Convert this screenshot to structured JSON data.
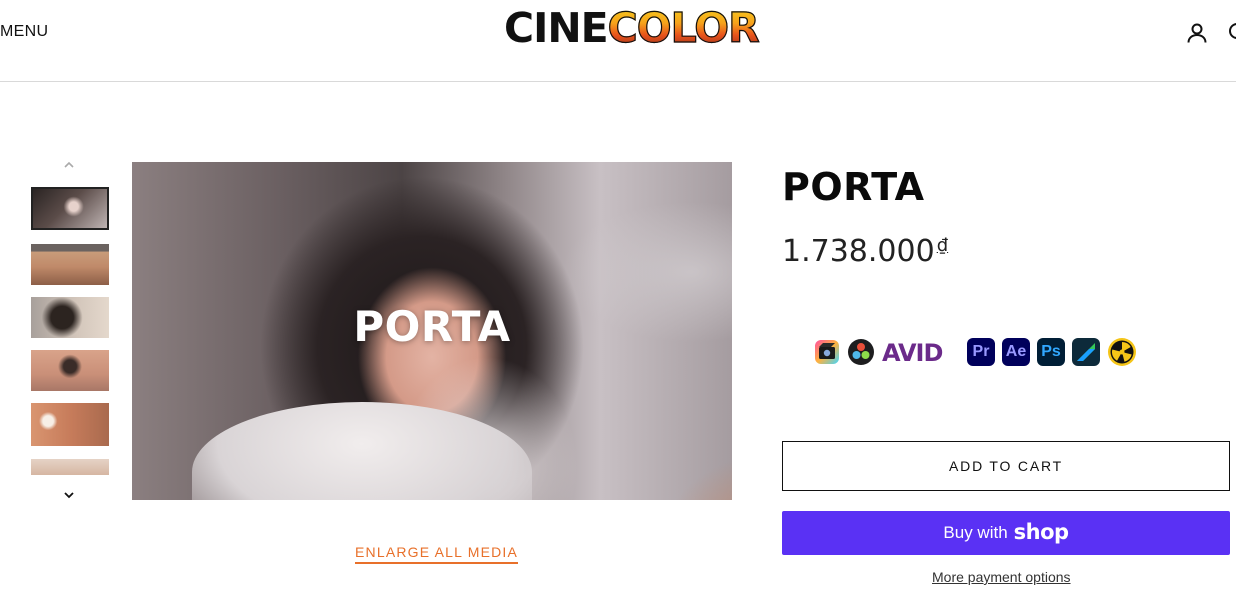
{
  "header": {
    "menu_label": "MENU",
    "logo": {
      "part1": "CINE",
      "part2": "COLOR"
    },
    "icons": {
      "account": "account-icon",
      "search": "search-icon"
    }
  },
  "gallery": {
    "thumbnails": [
      {
        "label": "PORTA thumbnail 1",
        "active": true
      },
      {
        "label": "PORTA thumbnail 2"
      },
      {
        "label": "PORTA thumbnail 3"
      },
      {
        "label": "PORTA thumbnail 4"
      },
      {
        "label": "PORTA thumbnail 5"
      },
      {
        "label": "PORTA thumbnail 6"
      }
    ],
    "main_overlay_text": "PORTA",
    "enlarge_label": "ENLARGE ALL MEDIA",
    "icons": {
      "up": "chevron-up-icon",
      "down": "chevron-down-icon"
    }
  },
  "product": {
    "title": "PORTA",
    "price_value": "1.738.000",
    "price_currency": "₫",
    "software_icons": [
      "final-cut-pro-icon",
      "davinci-resolve-icon",
      "avid-icon",
      "premiere-pro-icon",
      "after-effects-icon",
      "photoshop-icon",
      "lumafusion-icon",
      "nuke-icon"
    ],
    "software_labels": {
      "avid": "AVID",
      "premiere": "Pr",
      "after_effects": "Ae",
      "photoshop": "Ps"
    },
    "add_to_cart_label": "ADD TO CART",
    "buy_with_label": "Buy with",
    "shop_word": "shop",
    "more_payment_label": "More payment options"
  },
  "colors": {
    "accent": "#e8702a",
    "shop_pay": "#5a31f4",
    "text": "#111111"
  }
}
